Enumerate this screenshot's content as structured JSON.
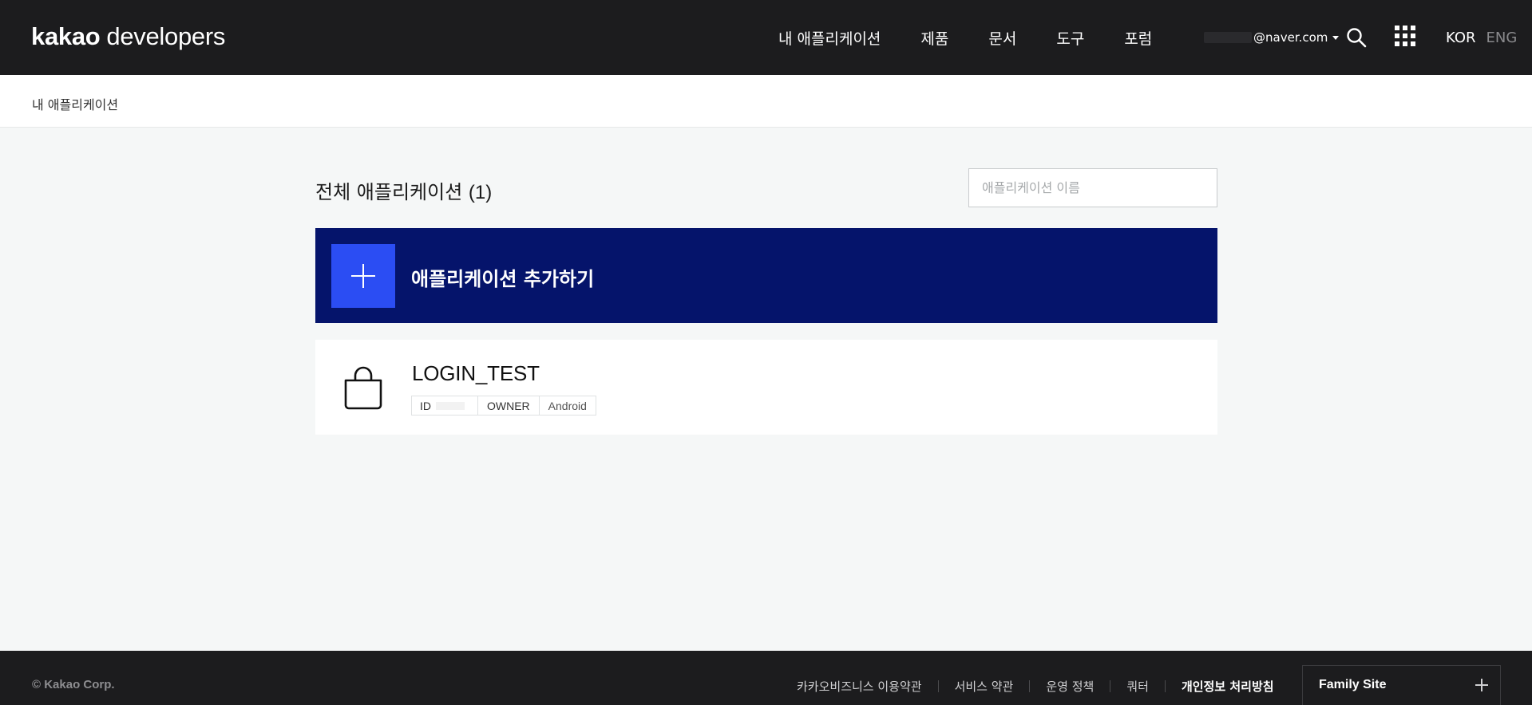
{
  "header": {
    "brand_primary": "kakao",
    "brand_secondary": "developers",
    "nav": [
      "내 애플리케이션",
      "제품",
      "문서",
      "도구",
      "포럼"
    ],
    "account_email": "@naver.com",
    "lang_active": "KOR",
    "lang_other": "ENG",
    "icons": [
      "search-icon",
      "apps-grid-icon",
      "chevron-down-icon"
    ]
  },
  "breadcrumb": "내 애플리케이션",
  "main": {
    "title_text": "전체 애플리케이션",
    "title_count": "(1)",
    "search_placeholder": "애플리케이션 이름",
    "add_app_label": "애플리케이션 추가하기",
    "apps": [
      {
        "name": "LOGIN_TEST",
        "tags": {
          "id": "ID",
          "role": "OWNER",
          "platform": "Android"
        },
        "icon": "shopping-bag-icon"
      }
    ]
  },
  "footer": {
    "copyright": "© Kakao Corp.",
    "links": [
      "카카오비즈니스 이용약관",
      "서비스 약관",
      "운영 정책",
      "쿼터",
      "개인정보 처리방침"
    ],
    "family_site": "Family Site"
  },
  "colors": {
    "header_bg": "#1c1c1e",
    "page_bg": "#f5f7f7",
    "add_banner_bg": "#05146b",
    "add_plus_bg": "#2b4df3"
  }
}
